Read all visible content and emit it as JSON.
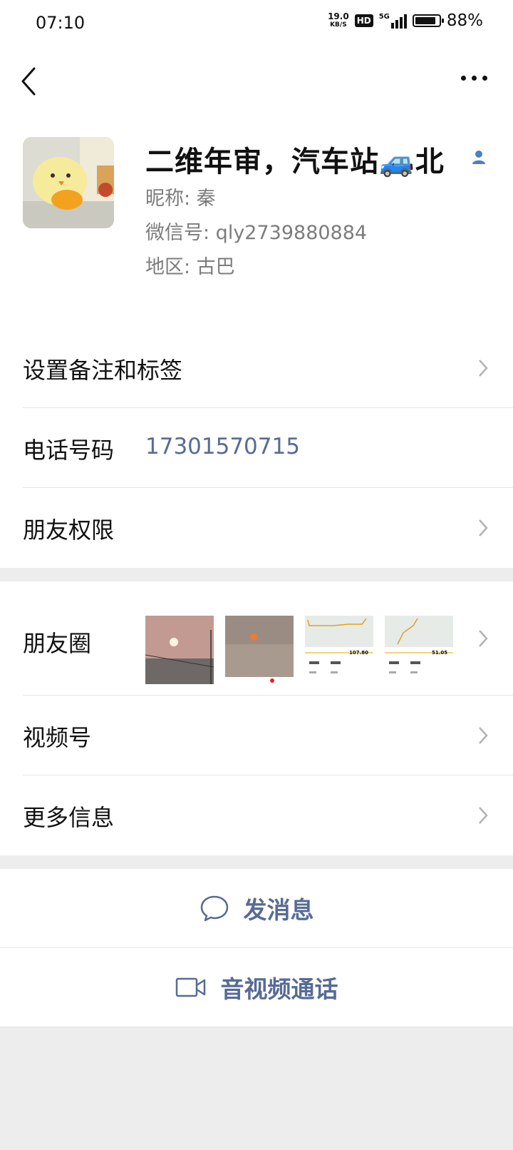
{
  "status_bar": {
    "time": "07:10",
    "net_speed_value": "19.0",
    "net_speed_unit": "KB/S",
    "hd_label": "HD",
    "network_type": "5G",
    "battery_percent": "88%",
    "battery_level": 0.88
  },
  "nav": {
    "back_icon": "chevron-left-icon",
    "more_icon": "more-dots-icon"
  },
  "profile": {
    "display_name": "二维年审，汽车站🚙北",
    "nickname_line": "昵称: 秦",
    "wechat_id_line": "微信号: qly2739880884",
    "region_line": "地区: 古巴"
  },
  "rows": {
    "remark_tags": "设置备注和标签",
    "phone_label": "电话号码",
    "phone_value": "17301570715",
    "friend_permissions": "朋友权限",
    "moments": "朋友圈",
    "channels": "视频号",
    "more_info": "更多信息"
  },
  "moments_thumbs": {
    "thumb3_value": "107.80",
    "thumb4_value": "51.05"
  },
  "actions": {
    "send_message": "发消息",
    "video_call": "音视频通话"
  },
  "colors": {
    "link_blue": "#576b95",
    "background": "#ededed",
    "text": "#111111",
    "secondary": "#7c7c7c"
  }
}
